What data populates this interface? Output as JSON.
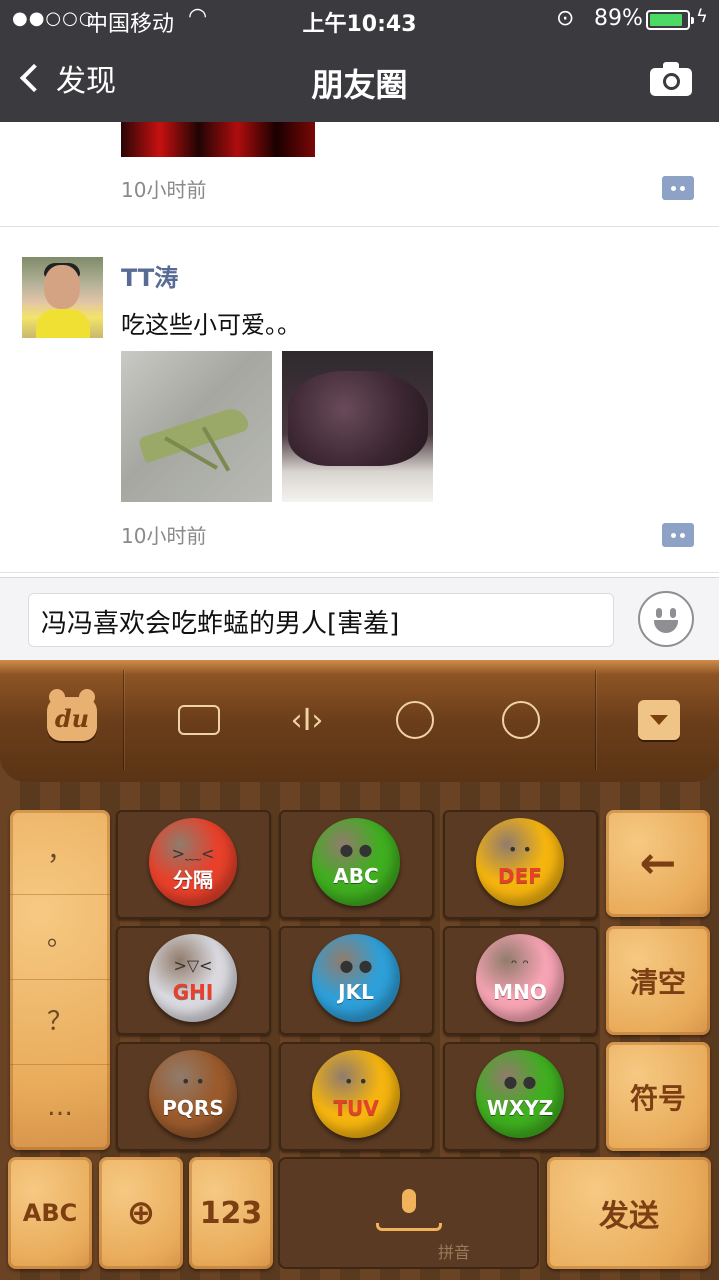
{
  "status_bar": {
    "signal": "●●○○○",
    "carrier": "中国移动",
    "time": "上午10:43",
    "battery_percent": "89%",
    "battery_level": 0.89,
    "battery_color": "#4cd964"
  },
  "nav": {
    "back_label": "发现",
    "title": "朋友圈"
  },
  "feed": {
    "posts": [
      {
        "timestamp": "10小时前"
      },
      {
        "author": "TT涛",
        "text": "吃这些小可爱。。",
        "timestamp": "10小时前"
      }
    ]
  },
  "comment_input": {
    "value": "冯冯喜欢会吃蚱蜢的男人[害羞]"
  },
  "keyboard": {
    "logo": "du",
    "punctuation": [
      "，",
      "。",
      "？",
      "…"
    ],
    "keys": [
      {
        "label": "分隔",
        "color": "#e8402a"
      },
      {
        "label": "ABC",
        "color": "#3fae1f"
      },
      {
        "label": "DEF",
        "color": "#f5b40f"
      },
      {
        "label": "GHI",
        "color": "#d9d9df"
      },
      {
        "label": "JKL",
        "color": "#2e9fd8"
      },
      {
        "label": "MNO",
        "color": "#f6a3b3"
      },
      {
        "label": "PQRS",
        "color": "#9a5a2c"
      },
      {
        "label": "TUV",
        "color": "#f5b40f"
      },
      {
        "label": "WXYZ",
        "color": "#3fae1f"
      }
    ],
    "backspace": "←",
    "clear": "清空",
    "symbols": "符号",
    "abc": "ABC",
    "num": "123",
    "send": "发送",
    "space_hint": "拼音"
  }
}
